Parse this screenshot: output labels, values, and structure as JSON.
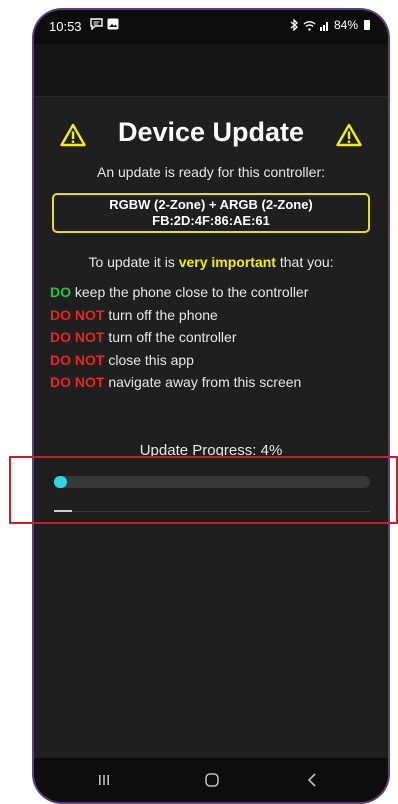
{
  "status_bar": {
    "time": "10:53",
    "battery": "84%"
  },
  "main": {
    "title": "Device Update",
    "subtitle": "An update is ready for this controller:",
    "device_name": "RGBW (2-Zone) + ARGB (2-Zone)",
    "device_mac": "FB:2D:4F:86:AE:61",
    "intro_before": "To update it is ",
    "intro_highlight": "very important",
    "intro_after": " that you:",
    "rules": [
      {
        "prefix": "DO",
        "text": " keep the phone close to the controller"
      },
      {
        "prefix": "DO NOT",
        "text": " turn off the phone"
      },
      {
        "prefix": "DO NOT",
        "text": " turn off the controller"
      },
      {
        "prefix": "DO NOT",
        "text": " close this app"
      },
      {
        "prefix": "DO NOT",
        "text": " navigate away from this screen"
      }
    ],
    "progress_label": "Update Progress: 4%",
    "progress_fraction": 0.04
  },
  "colors": {
    "accent_progress": "#32d6e6",
    "highlight_yellow": "#f4ec1a",
    "do_green": "#27c24c",
    "dont_red": "#e62525",
    "annotation_red": "#c8202a"
  },
  "icons": {
    "warning": "warning-triangle-icon",
    "recents": "recents-icon",
    "home": "home-icon",
    "back": "back-icon"
  }
}
